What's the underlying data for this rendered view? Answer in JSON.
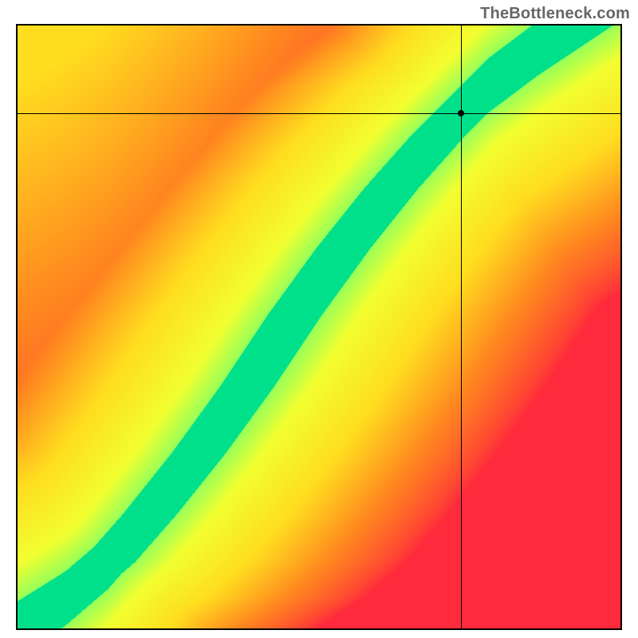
{
  "attribution": "TheBottleneck.com",
  "chart_data": {
    "type": "heatmap",
    "title": "",
    "xlabel": "",
    "ylabel": "",
    "x_range": [
      0,
      1
    ],
    "y_range": [
      0,
      1
    ],
    "marker": {
      "x": 0.735,
      "y": 0.855
    },
    "crosshair": {
      "x": 0.735,
      "y": 0.855
    },
    "ridge": {
      "description": "Green optimal-balance band; x,y normalized 0..1, origin bottom-left",
      "points": [
        {
          "x": 0.0,
          "y": 0.0
        },
        {
          "x": 0.08,
          "y": 0.05
        },
        {
          "x": 0.15,
          "y": 0.11
        },
        {
          "x": 0.22,
          "y": 0.19
        },
        {
          "x": 0.3,
          "y": 0.29
        },
        {
          "x": 0.38,
          "y": 0.4
        },
        {
          "x": 0.46,
          "y": 0.52
        },
        {
          "x": 0.54,
          "y": 0.63
        },
        {
          "x": 0.62,
          "y": 0.73
        },
        {
          "x": 0.7,
          "y": 0.82
        },
        {
          "x": 0.78,
          "y": 0.9
        },
        {
          "x": 0.86,
          "y": 0.96
        },
        {
          "x": 0.92,
          "y": 1.0
        }
      ],
      "half_width": 0.045
    },
    "color_stops": [
      {
        "t": 0.0,
        "color": "#ff2a3c"
      },
      {
        "t": 0.35,
        "color": "#ff8a1f"
      },
      {
        "t": 0.6,
        "color": "#ffde1f"
      },
      {
        "t": 0.82,
        "color": "#f2ff30"
      },
      {
        "t": 0.95,
        "color": "#7dff66"
      },
      {
        "t": 1.0,
        "color": "#00e08a"
      }
    ],
    "corner_bias": {
      "top_left": 0.6,
      "bottom_right": 0.0
    }
  }
}
